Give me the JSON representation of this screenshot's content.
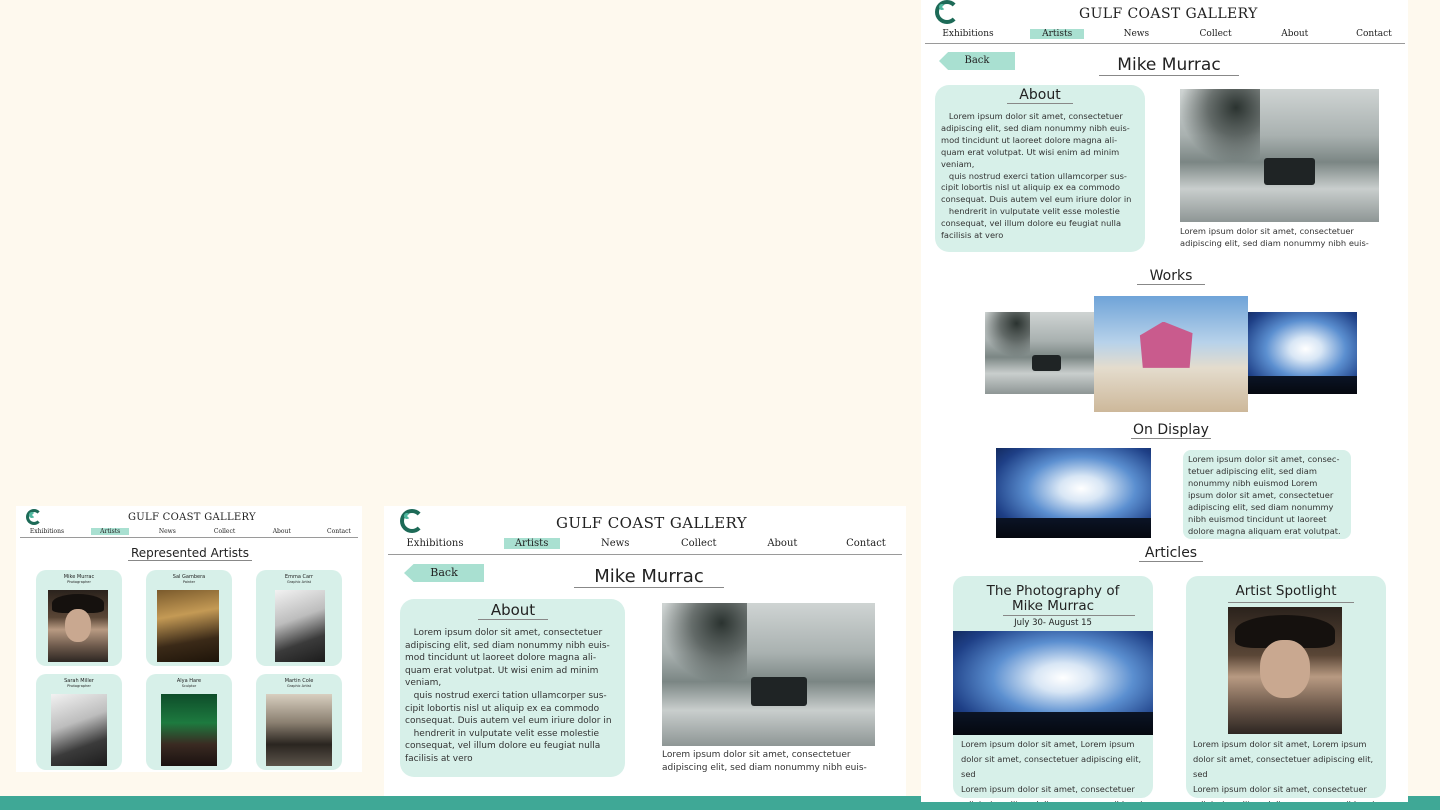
{
  "brand": {
    "name": "GULF COAST GALLERY",
    "logo_icon": "gulf-coast-logo-icon"
  },
  "nav": [
    "Exhibitions",
    "Artists",
    "News",
    "Collect",
    "About",
    "Contact"
  ],
  "nav_active": "Artists",
  "artists_page": {
    "title": "Represented Artists",
    "artists": [
      {
        "name": "Mike Murrac",
        "role": "Photographer"
      },
      {
        "name": "Sal Gambera",
        "role": "Painter"
      },
      {
        "name": "Emma Carr",
        "role": "Graphic Artist"
      },
      {
        "name": "Sarah Miller",
        "role": "Photographer"
      },
      {
        "name": "Alya Hare",
        "role": "Sculptor"
      },
      {
        "name": "Martin Cole",
        "role": "Graphic Artist"
      }
    ]
  },
  "artist_page": {
    "back_label": "Back",
    "artist_name": "Mike Murrac",
    "about_title": "About",
    "about_text": "   Lorem ipsum dolor sit amet, consectetuer\nadipiscing elit, sed diam nonummy nibh euis-\nmod tincidunt ut laoreet dolore magna ali-\nquam erat volutpat. Ut wisi enim ad minim\nveniam,\n   quis nostrud exerci tation ullamcorper sus-\ncipit lobortis nisl ut aliquip ex ea commodo\nconsequat. Duis autem vel eum iriure dolor in\n   hendrerit in vulputate velit esse molestie\nconsequat, vel illum dolore eu feugiat nulla\nfacilisis at vero",
    "photo_caption": "Lorem ipsum dolor sit amet, consectetuer\nadipiscing elit, sed diam nonummy nibh euis-",
    "works_title": "Works",
    "on_display_title": "On Display",
    "on_display_text": "Lorem ipsum dolor sit amet, consec-\ntetuer adipiscing elit, sed diam\nnonummy nibh euismod Lorem\nipsum dolor sit amet, consectetuer\nadipiscing elit, sed diam nonummy\nnibh euismod tincidunt ut laoreet\ndolore magna aliquam erat volutpat.",
    "articles_title": "Articles",
    "articles": [
      {
        "title": "The Photography of\nMike Murrac",
        "date": "July 30- August 15",
        "text": "Lorem ipsum dolor sit amet, Lorem ipsum\ndolor sit amet, consectetuer adipiscing elit, sed\nLorem ipsum dolor sit amet, consectetuer\nadipiscing elit, sed diam nonummy nibh euis"
      },
      {
        "title": "Artist Spotlight",
        "text": "Lorem ipsum dolor sit amet, Lorem ipsum\ndolor sit amet, consectetuer adipiscing elit, sed\nLorem ipsum dolor sit amet, consectetuer\nadipiscing elit, sed diam nonummy nibh euis"
      }
    ]
  },
  "colors": {
    "accent": "#a9e0d1",
    "card": "#d7f0e9",
    "background": "#fef9ee",
    "bottom_bar": "#3fa896",
    "logo": "#1d6a57"
  }
}
